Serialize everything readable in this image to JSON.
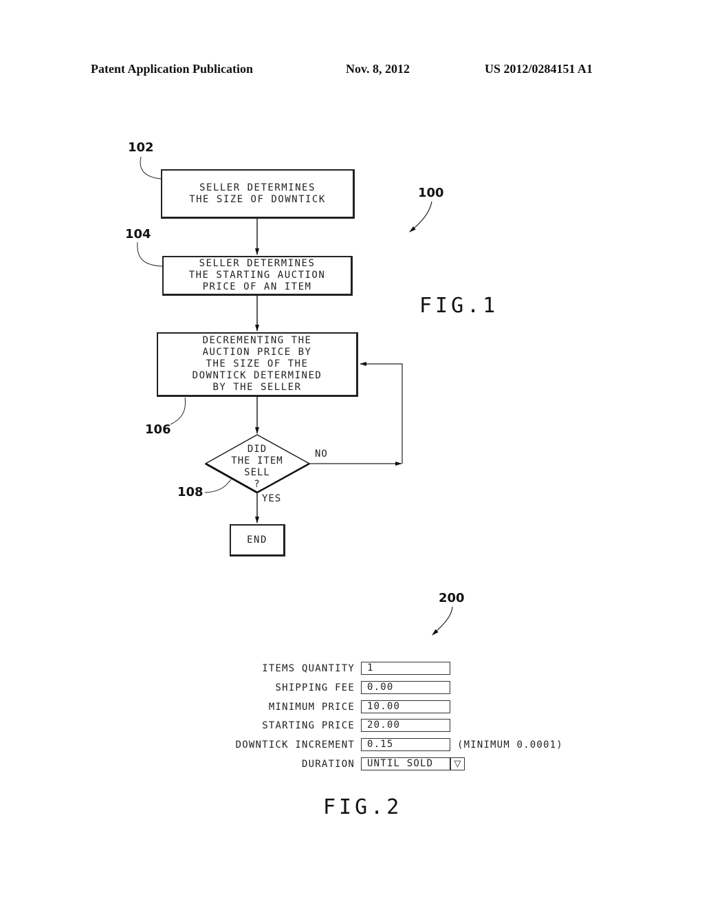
{
  "header": {
    "publication": "Patent Application Publication",
    "date": "Nov. 8, 2012",
    "number": "US 2012/0284151 A1"
  },
  "fig1": {
    "ref": "100",
    "caption": "FIG.1",
    "steps": [
      {
        "ref": "102",
        "text": "SELLER DETERMINES\nTHE SIZE OF DOWNTICK"
      },
      {
        "ref": "104",
        "text": "SELLER DETERMINES\nTHE STARTING AUCTION\nPRICE OF AN ITEM"
      },
      {
        "ref": "106",
        "text": "DECREMENTING THE\nAUCTION PRICE BY\nTHE SIZE OF THE\nDOWNTICK DETERMINED\nBY THE SELLER"
      }
    ],
    "decision": {
      "ref": "108",
      "text": "DID\nTHE ITEM\nSELL\n?",
      "no_label": "NO",
      "yes_label": "YES"
    },
    "end_label": "END"
  },
  "fig2": {
    "ref": "200",
    "caption": "FIG.2",
    "fields": [
      {
        "label": "ITEMS QUANTITY",
        "value": "1"
      },
      {
        "label": "SHIPPING FEE",
        "value": "0.00"
      },
      {
        "label": "MINIMUM PRICE",
        "value": "10.00"
      },
      {
        "label": "STARTING PRICE",
        "value": "20.00"
      },
      {
        "label": "DOWNTICK INCREMENT",
        "value": "0.15",
        "note": "(MINIMUM 0.0001)"
      },
      {
        "label": "DURATION",
        "value": "UNTIL SOLD",
        "dropdown_icon": "triangle-down"
      }
    ]
  }
}
